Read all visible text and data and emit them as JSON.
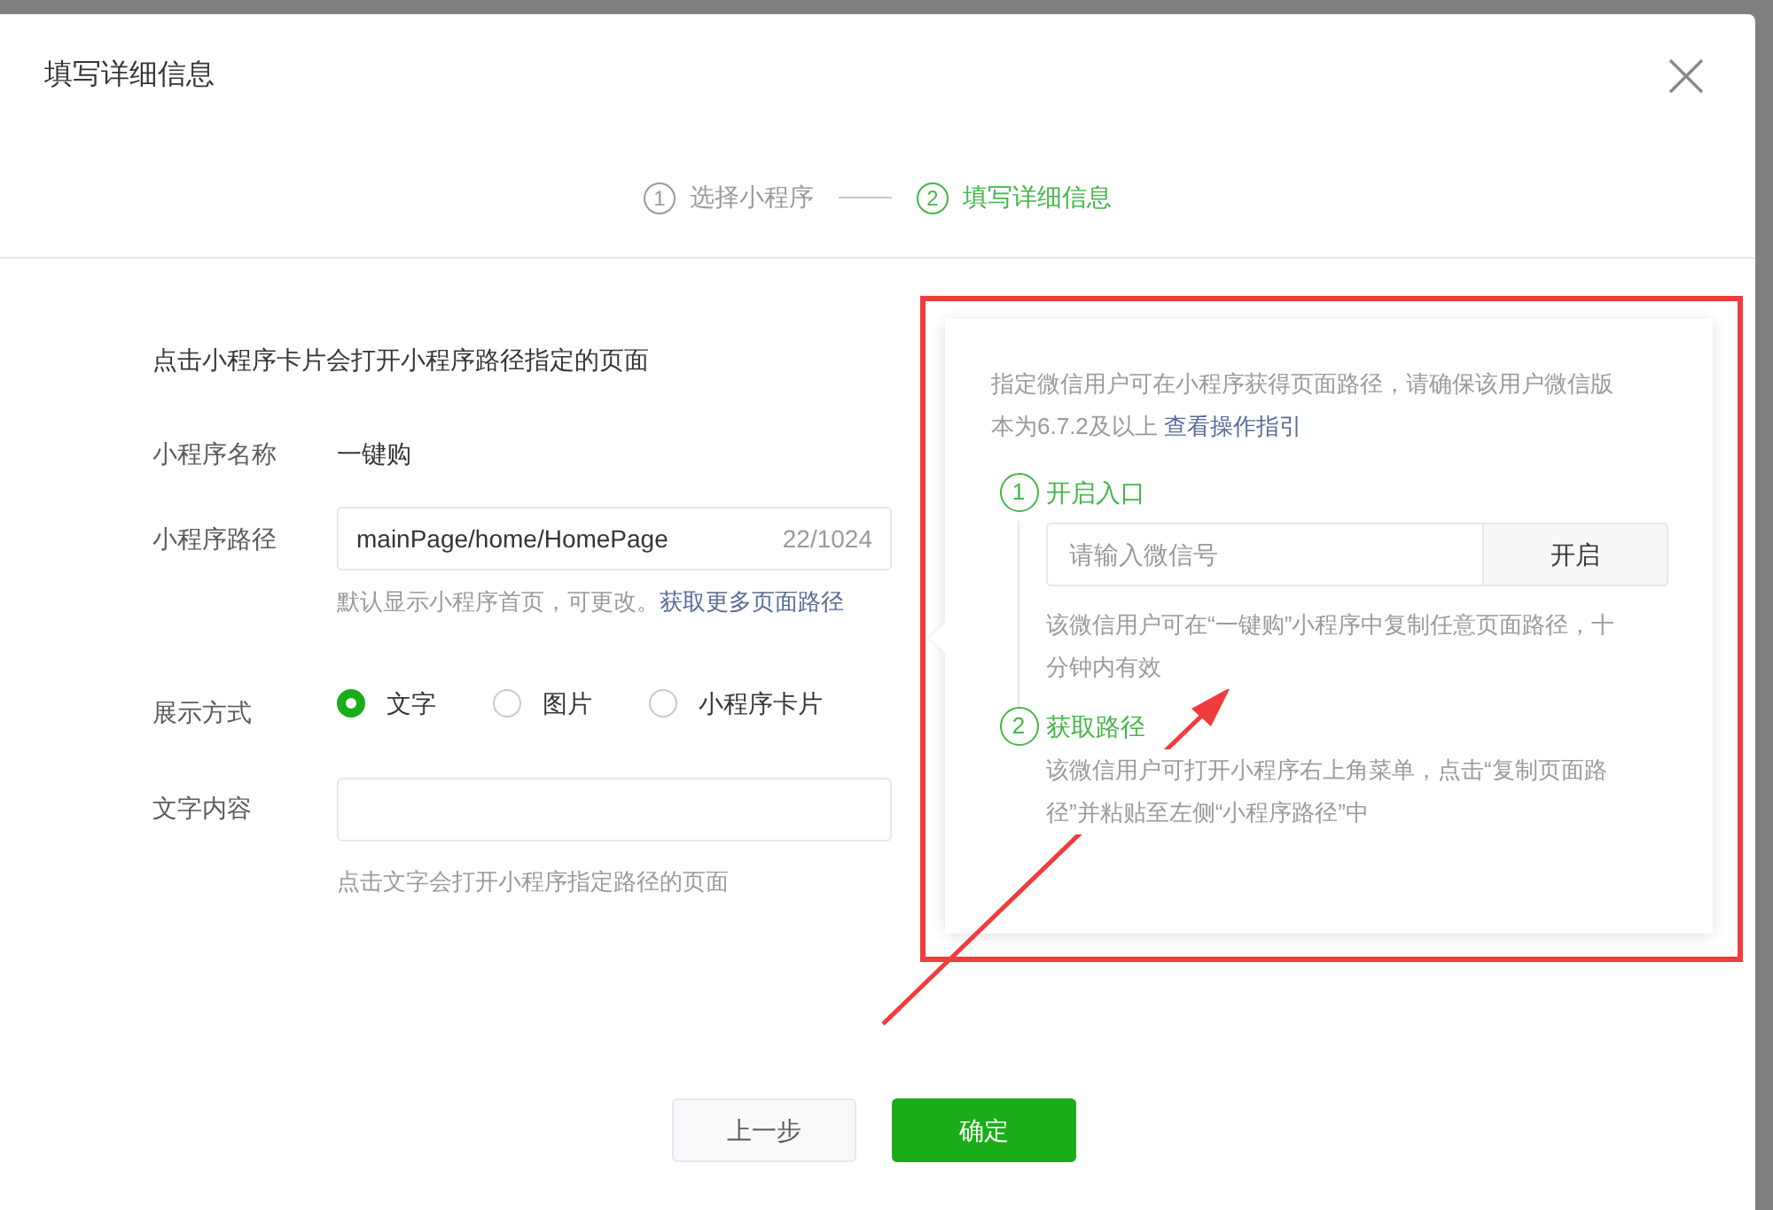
{
  "dialog": {
    "title": "填写详细信息"
  },
  "steps": [
    {
      "number": "1",
      "label": "选择小程序",
      "selected": false
    },
    {
      "number": "2",
      "label": "填写详细信息",
      "selected": true
    }
  ],
  "form": {
    "intro": "点击小程序卡片会打开小程序路径指定的页面",
    "name_label": "小程序名称",
    "name_value": "一键购",
    "path_label": "小程序路径",
    "path_value": "mainPage/home/HomePage",
    "path_count": "22/1024",
    "path_help": "默认显示小程序首页，可更改。",
    "path_link": "获取更多页面路径",
    "display_label": "展示方式",
    "display_options": [
      {
        "label": "文字",
        "selected": true
      },
      {
        "label": "图片",
        "selected": false
      },
      {
        "label": "小程序卡片",
        "selected": false
      }
    ],
    "text_label": "文字内容",
    "text_help": "点击文字会打开小程序指定路径的页面"
  },
  "popover": {
    "description": "指定微信用户可在小程序获得页面路径，请确保该用户微信版本为6.7.2及以上",
    "guide_link": "查看操作指引",
    "steps": [
      {
        "number": "1",
        "title": "开启入口",
        "placeholder": "请输入微信号",
        "button": "开启",
        "note": "该微信用户可在“一键购”小程序中复制任意页面路径，十分钟内有效"
      },
      {
        "number": "2",
        "title": "获取路径",
        "note": "该微信用户可打开小程序右上角菜单，点击“复制页面路径”并粘贴至左侧“小程序路径”中"
      }
    ]
  },
  "buttons": {
    "back": "上一步",
    "confirm": "确定"
  }
}
